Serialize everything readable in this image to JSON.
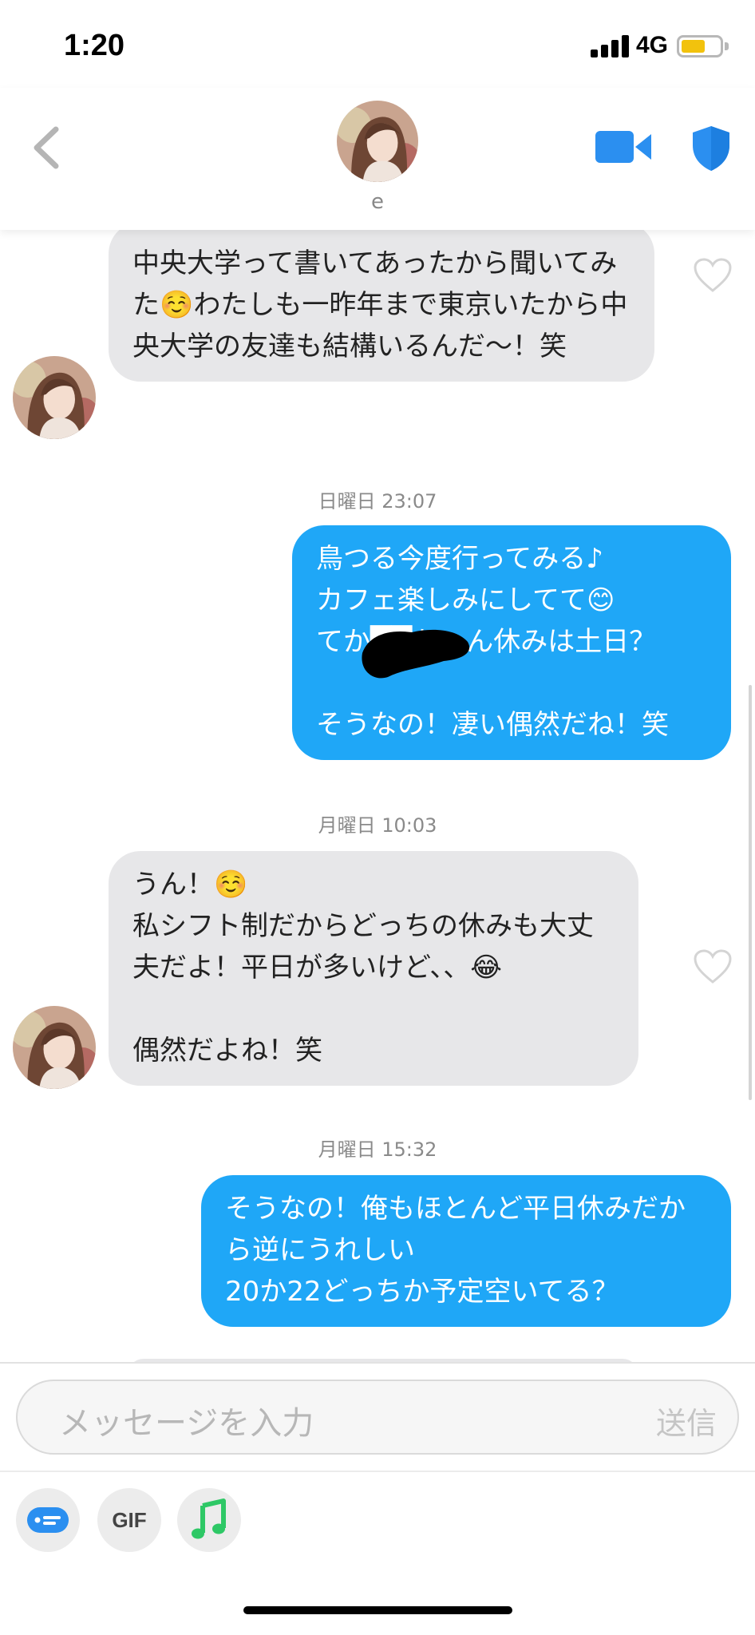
{
  "status": {
    "time": "1:20",
    "network": "4G",
    "battery_level": 0.62
  },
  "header": {
    "contact_name": "e"
  },
  "messages": [
    {
      "direction": "in",
      "text": "中央大学って書いてあったから聞いてみた☺️わたしも一昨年まで東京いたから中央大学の友達も結構いるんだ〜！笑"
    },
    {
      "direction": "out",
      "timestamp": "日曜日 23:07",
      "text": "鳥つる今度行ってみる♪\nカフェ楽しみにしてて😊\nてか██ちゃん休みは土日？\n\nそうなの！凄い偶然だね！笑"
    },
    {
      "direction": "in",
      "timestamp": "月曜日 10:03",
      "text": "うん！☺️\n私シフト制だからどっちの休みも大丈夫だよ！平日が多いけど、、😂\n\n偶然だよね！笑"
    },
    {
      "direction": "out",
      "timestamp": "月曜日 15:32",
      "text": "そうなの！俺もほとんど平日休みだから逆にうれしい\n20か22どっちか予定空いてる？"
    }
  ],
  "composer": {
    "placeholder": "メッセージを入力",
    "send_label": "送信"
  },
  "toolbar": {
    "gif_label": "GIF"
  },
  "colors": {
    "accent": "#1fa7f7",
    "incoming_bubble": "#e7e7e9",
    "icon_blue": "#2b8ff0",
    "music_green": "#2ec866"
  }
}
